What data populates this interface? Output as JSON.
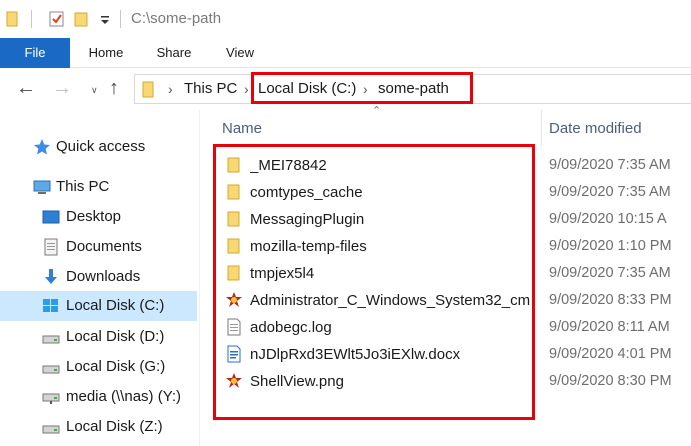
{
  "window": {
    "title": "C:\\some-path"
  },
  "ribbon": {
    "tabs": [
      {
        "label": "File"
      },
      {
        "label": "Home"
      },
      {
        "label": "Share"
      },
      {
        "label": "View"
      }
    ]
  },
  "address": {
    "crumbs": [
      "This PC",
      "Local Disk (C:)",
      "some-path"
    ]
  },
  "sidebar": {
    "items": [
      {
        "label": "Quick access",
        "icon": "star-icon"
      },
      {
        "label": "This PC",
        "icon": "computer-icon"
      },
      {
        "label": "Desktop",
        "icon": "desktop-icon"
      },
      {
        "label": "Documents",
        "icon": "documents-icon"
      },
      {
        "label": "Downloads",
        "icon": "downloads-icon"
      },
      {
        "label": "Local Disk (C:)",
        "icon": "windows-drive-icon",
        "selected": true
      },
      {
        "label": "Local Disk (D:)",
        "icon": "drive-icon"
      },
      {
        "label": "Local Disk (G:)",
        "icon": "drive-icon"
      },
      {
        "label": "media (\\\\nas) (Y:)",
        "icon": "network-drive-icon"
      },
      {
        "label": "Local Disk (Z:)",
        "icon": "drive-icon"
      }
    ]
  },
  "columns": {
    "name": "Name",
    "date_modified": "Date modified"
  },
  "files": [
    {
      "name": "_MEI78842",
      "date": "9/09/2020 7:35 AM",
      "icon": "folder-icon"
    },
    {
      "name": "comtypes_cache",
      "date": "9/09/2020 7:35 AM",
      "icon": "folder-icon"
    },
    {
      "name": "MessagingPlugin",
      "date": "9/09/2020 10:15 A",
      "icon": "folder-icon"
    },
    {
      "name": "mozilla-temp-files",
      "date": "9/09/2020 1:10 PM",
      "icon": "folder-icon"
    },
    {
      "name": "tmpjex5l4",
      "date": "9/09/2020 7:35 AM",
      "icon": "folder-icon"
    },
    {
      "name": "Administrator_C_Windows_System32_cm...",
      "date": "9/09/2020 8:33 PM",
      "icon": "image-app-icon"
    },
    {
      "name": "adobegc.log",
      "date": "9/09/2020 8:11 AM",
      "icon": "text-file-icon"
    },
    {
      "name": "nJDlpRxd3EWlt5Jo3iEXlw.docx",
      "date": "9/09/2020 4:01 PM",
      "icon": "docx-file-icon"
    },
    {
      "name": "ShellView.png",
      "date": "9/09/2020 8:30 PM",
      "icon": "image-app-icon"
    }
  ],
  "colors": {
    "accent": "#1a69c4",
    "selection": "#cce8ff",
    "highlight": "#e8000b",
    "folder": "#f8d775"
  }
}
